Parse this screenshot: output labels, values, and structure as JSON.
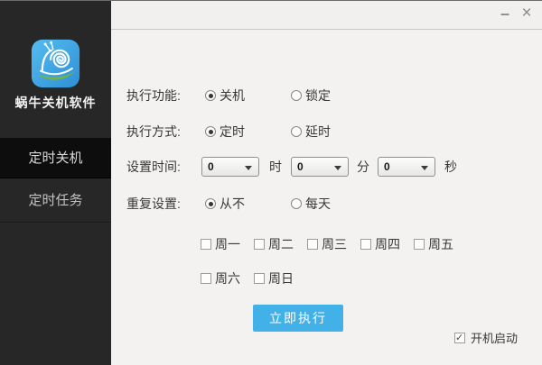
{
  "app": {
    "name": "蜗牛关机软件"
  },
  "window_controls": {
    "minimize": "–",
    "close": "×"
  },
  "sidebar": {
    "items": [
      {
        "label": "定时关机",
        "active": true
      },
      {
        "label": "定时任务",
        "active": false
      }
    ]
  },
  "form": {
    "function_row": {
      "label": "执行功能:",
      "options": [
        {
          "label": "关机",
          "selected": true
        },
        {
          "label": "锁定",
          "selected": false
        }
      ]
    },
    "mode_row": {
      "label": "执行方式:",
      "options": [
        {
          "label": "定时",
          "selected": true
        },
        {
          "label": "延时",
          "selected": false
        }
      ]
    },
    "time_row": {
      "label": "设置时间:",
      "selects": [
        {
          "value": "0",
          "unit": "时"
        },
        {
          "value": "0",
          "unit": "分"
        },
        {
          "value": "0",
          "unit": "秒"
        }
      ]
    },
    "repeat_row": {
      "label": "重复设置:",
      "options": [
        {
          "label": "从不",
          "selected": true
        },
        {
          "label": "每天",
          "selected": false
        }
      ]
    },
    "weekdays_row1": [
      {
        "label": "周一",
        "checked": false
      },
      {
        "label": "周二",
        "checked": false
      },
      {
        "label": "周三",
        "checked": false
      },
      {
        "label": "周四",
        "checked": false
      },
      {
        "label": "周五",
        "checked": false
      }
    ],
    "weekdays_row2": [
      {
        "label": "周六",
        "checked": false
      },
      {
        "label": "周日",
        "checked": false
      }
    ],
    "execute_button": "立即执行",
    "autostart": {
      "label": "开机启动",
      "checked": true
    }
  },
  "colors": {
    "accent": "#41b1e8",
    "sidebar_bg": "#272727",
    "sidebar_active_bg": "#0d0d0d",
    "titlebar_bg": "#f1f0ef",
    "content_bg": "#f3f2f1",
    "leaf_green": "#72b43c"
  }
}
